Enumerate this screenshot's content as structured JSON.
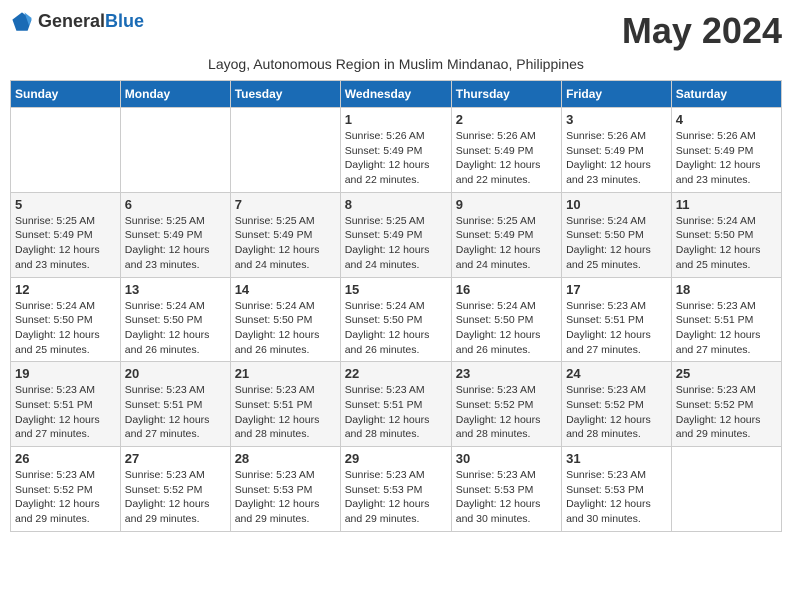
{
  "header": {
    "logo_general": "General",
    "logo_blue": "Blue",
    "month_year": "May 2024",
    "subtitle": "Layog, Autonomous Region in Muslim Mindanao, Philippines"
  },
  "weekdays": [
    "Sunday",
    "Monday",
    "Tuesday",
    "Wednesday",
    "Thursday",
    "Friday",
    "Saturday"
  ],
  "weeks": [
    [
      {
        "day": "",
        "info": ""
      },
      {
        "day": "",
        "info": ""
      },
      {
        "day": "",
        "info": ""
      },
      {
        "day": "1",
        "info": "Sunrise: 5:26 AM\nSunset: 5:49 PM\nDaylight: 12 hours\nand 22 minutes."
      },
      {
        "day": "2",
        "info": "Sunrise: 5:26 AM\nSunset: 5:49 PM\nDaylight: 12 hours\nand 22 minutes."
      },
      {
        "day": "3",
        "info": "Sunrise: 5:26 AM\nSunset: 5:49 PM\nDaylight: 12 hours\nand 23 minutes."
      },
      {
        "day": "4",
        "info": "Sunrise: 5:26 AM\nSunset: 5:49 PM\nDaylight: 12 hours\nand 23 minutes."
      }
    ],
    [
      {
        "day": "5",
        "info": "Sunrise: 5:25 AM\nSunset: 5:49 PM\nDaylight: 12 hours\nand 23 minutes."
      },
      {
        "day": "6",
        "info": "Sunrise: 5:25 AM\nSunset: 5:49 PM\nDaylight: 12 hours\nand 23 minutes."
      },
      {
        "day": "7",
        "info": "Sunrise: 5:25 AM\nSunset: 5:49 PM\nDaylight: 12 hours\nand 24 minutes."
      },
      {
        "day": "8",
        "info": "Sunrise: 5:25 AM\nSunset: 5:49 PM\nDaylight: 12 hours\nand 24 minutes."
      },
      {
        "day": "9",
        "info": "Sunrise: 5:25 AM\nSunset: 5:49 PM\nDaylight: 12 hours\nand 24 minutes."
      },
      {
        "day": "10",
        "info": "Sunrise: 5:24 AM\nSunset: 5:50 PM\nDaylight: 12 hours\nand 25 minutes."
      },
      {
        "day": "11",
        "info": "Sunrise: 5:24 AM\nSunset: 5:50 PM\nDaylight: 12 hours\nand 25 minutes."
      }
    ],
    [
      {
        "day": "12",
        "info": "Sunrise: 5:24 AM\nSunset: 5:50 PM\nDaylight: 12 hours\nand 25 minutes."
      },
      {
        "day": "13",
        "info": "Sunrise: 5:24 AM\nSunset: 5:50 PM\nDaylight: 12 hours\nand 26 minutes."
      },
      {
        "day": "14",
        "info": "Sunrise: 5:24 AM\nSunset: 5:50 PM\nDaylight: 12 hours\nand 26 minutes."
      },
      {
        "day": "15",
        "info": "Sunrise: 5:24 AM\nSunset: 5:50 PM\nDaylight: 12 hours\nand 26 minutes."
      },
      {
        "day": "16",
        "info": "Sunrise: 5:24 AM\nSunset: 5:50 PM\nDaylight: 12 hours\nand 26 minutes."
      },
      {
        "day": "17",
        "info": "Sunrise: 5:23 AM\nSunset: 5:51 PM\nDaylight: 12 hours\nand 27 minutes."
      },
      {
        "day": "18",
        "info": "Sunrise: 5:23 AM\nSunset: 5:51 PM\nDaylight: 12 hours\nand 27 minutes."
      }
    ],
    [
      {
        "day": "19",
        "info": "Sunrise: 5:23 AM\nSunset: 5:51 PM\nDaylight: 12 hours\nand 27 minutes."
      },
      {
        "day": "20",
        "info": "Sunrise: 5:23 AM\nSunset: 5:51 PM\nDaylight: 12 hours\nand 27 minutes."
      },
      {
        "day": "21",
        "info": "Sunrise: 5:23 AM\nSunset: 5:51 PM\nDaylight: 12 hours\nand 28 minutes."
      },
      {
        "day": "22",
        "info": "Sunrise: 5:23 AM\nSunset: 5:51 PM\nDaylight: 12 hours\nand 28 minutes."
      },
      {
        "day": "23",
        "info": "Sunrise: 5:23 AM\nSunset: 5:52 PM\nDaylight: 12 hours\nand 28 minutes."
      },
      {
        "day": "24",
        "info": "Sunrise: 5:23 AM\nSunset: 5:52 PM\nDaylight: 12 hours\nand 28 minutes."
      },
      {
        "day": "25",
        "info": "Sunrise: 5:23 AM\nSunset: 5:52 PM\nDaylight: 12 hours\nand 29 minutes."
      }
    ],
    [
      {
        "day": "26",
        "info": "Sunrise: 5:23 AM\nSunset: 5:52 PM\nDaylight: 12 hours\nand 29 minutes."
      },
      {
        "day": "27",
        "info": "Sunrise: 5:23 AM\nSunset: 5:52 PM\nDaylight: 12 hours\nand 29 minutes."
      },
      {
        "day": "28",
        "info": "Sunrise: 5:23 AM\nSunset: 5:53 PM\nDaylight: 12 hours\nand 29 minutes."
      },
      {
        "day": "29",
        "info": "Sunrise: 5:23 AM\nSunset: 5:53 PM\nDaylight: 12 hours\nand 29 minutes."
      },
      {
        "day": "30",
        "info": "Sunrise: 5:23 AM\nSunset: 5:53 PM\nDaylight: 12 hours\nand 30 minutes."
      },
      {
        "day": "31",
        "info": "Sunrise: 5:23 AM\nSunset: 5:53 PM\nDaylight: 12 hours\nand 30 minutes."
      },
      {
        "day": "",
        "info": ""
      }
    ]
  ]
}
